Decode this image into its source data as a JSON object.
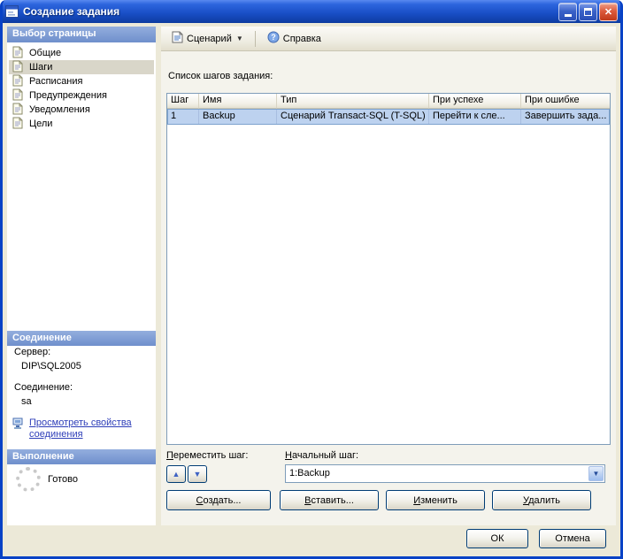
{
  "window": {
    "title": "Создание задания"
  },
  "sidebar": {
    "pages": {
      "header": "Выбор страницы",
      "items": [
        {
          "label": "Общие"
        },
        {
          "label": "Шаги"
        },
        {
          "label": "Расписания"
        },
        {
          "label": "Предупреждения"
        },
        {
          "label": "Уведомления"
        },
        {
          "label": "Цели"
        }
      ]
    },
    "connection": {
      "header": "Соединение",
      "server_label": "Сервер:",
      "server_value": "DIP\\SQL2005",
      "connection_label": "Соединение:",
      "connection_value": "sa",
      "view_properties_link": "Просмотреть свойства соединения"
    },
    "progress": {
      "header": "Выполнение",
      "status": "Готово"
    }
  },
  "toolbar": {
    "script_label": "Сценарий",
    "help_label": "Справка"
  },
  "main": {
    "steps_list_label": "Список шагов задания:",
    "table": {
      "columns": [
        "Шаг",
        "Имя",
        "Тип",
        "При успехе",
        "При ошибке"
      ],
      "rows": [
        {
          "step": "1",
          "name": "Backup",
          "type": "Сценарий Transact-SQL (T-SQL)",
          "on_success": "Перейти к сле...",
          "on_failure": "Завершить зада..."
        }
      ]
    },
    "move_step_label": "Переместить шаг:",
    "start_step_label": "Начальный шаг:",
    "start_step_value": "1:Backup",
    "buttons": {
      "create": "Создать...",
      "insert": "Вставить...",
      "edit": "Изменить",
      "delete": "Удалить"
    }
  },
  "footer": {
    "ok_label": "ОК",
    "cancel_label": "Отмена"
  },
  "colors": {
    "titlebar_blue": "#1A50C8",
    "section_header_blue": "#7F9BD4",
    "selection_blue": "#BDD2EF",
    "link_blue": "#2E3EB8",
    "face": "#ECE9D8"
  }
}
